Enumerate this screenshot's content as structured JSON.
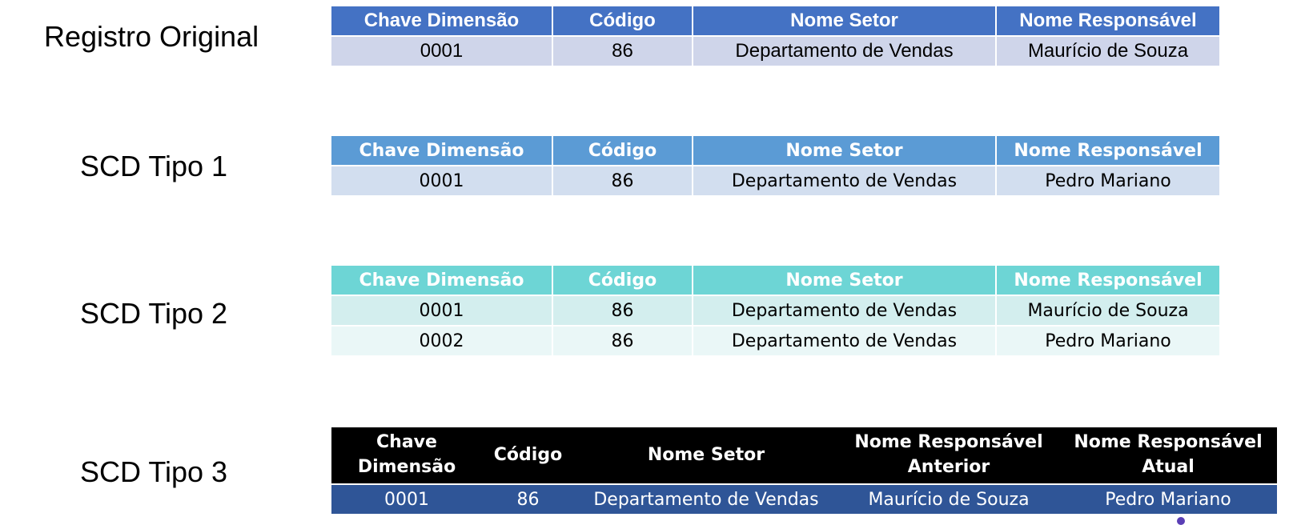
{
  "labels": {
    "original": "Registro Original",
    "scd1": "SCD Tipo 1",
    "scd2": "SCD Tipo 2",
    "scd3": "SCD Tipo 3"
  },
  "original": {
    "headers": [
      "Chave Dimensão",
      "Código",
      "Nome Setor",
      "Nome Responsável"
    ],
    "rows": [
      [
        "0001",
        "86",
        "Departamento de Vendas",
        "Maurício de Souza"
      ]
    ]
  },
  "scd1": {
    "headers": [
      "Chave Dimensão",
      "Código",
      "Nome Setor",
      "Nome Responsável"
    ],
    "rows": [
      [
        "0001",
        "86",
        "Departamento de Vendas",
        "Pedro Mariano"
      ]
    ]
  },
  "scd2": {
    "headers": [
      "Chave Dimensão",
      "Código",
      "Nome Setor",
      "Nome Responsável"
    ],
    "rows": [
      [
        "0001",
        "86",
        "Departamento de Vendas",
        "Maurício de Souza"
      ],
      [
        "0002",
        "86",
        "Departamento de Vendas",
        "Pedro Mariano"
      ]
    ]
  },
  "scd3": {
    "headers": [
      [
        "Chave",
        "Dimensão"
      ],
      [
        "Código"
      ],
      [
        "Nome Setor"
      ],
      [
        "Nome Responsável",
        "Anterior"
      ],
      [
        "Nome Responsável",
        "Atual"
      ]
    ],
    "rows": [
      [
        "0001",
        "86",
        "Departamento de Vendas",
        "Maurício de Souza",
        "Pedro Mariano"
      ]
    ]
  },
  "colors": {
    "original_header": "#4472c4",
    "original_row": "#cfd5ea",
    "scd1_header": "#5b9bd5",
    "scd1_row": "#d2deef",
    "scd2_header": "#6dd5d5",
    "scd2_row_1": "#d3eeee",
    "scd2_row_2": "#eaf7f7",
    "scd3_header": "#000000",
    "scd3_row": "#2f5597"
  }
}
